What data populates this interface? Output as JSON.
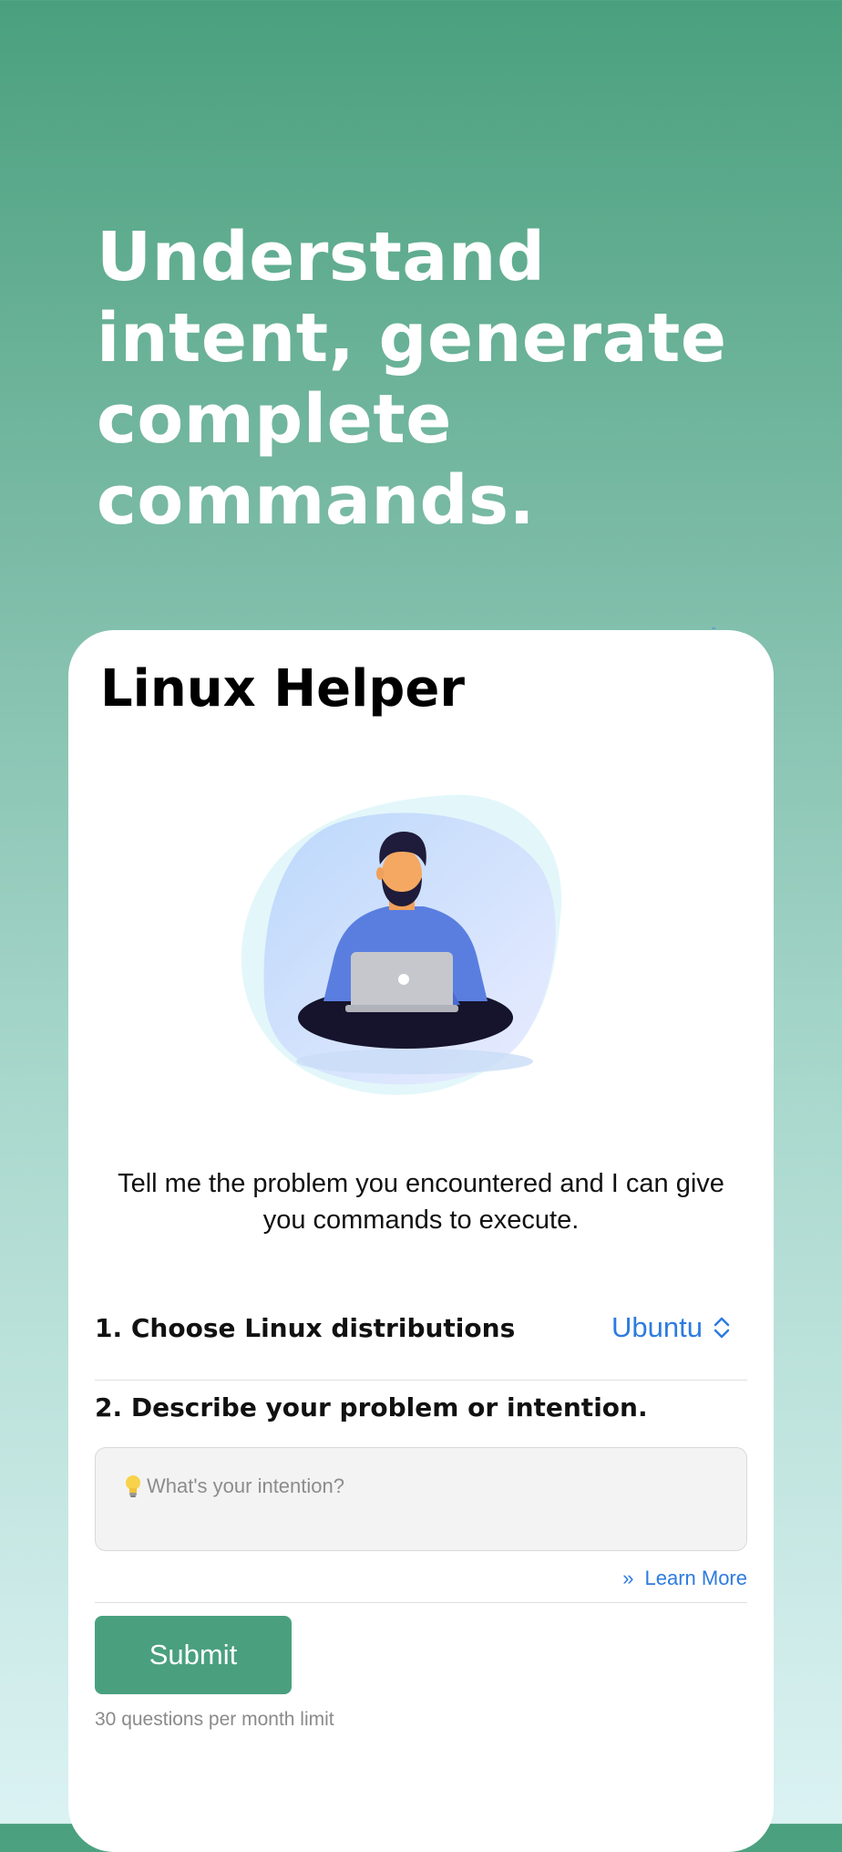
{
  "hero": {
    "headline": "Understand intent, generate complete commands."
  },
  "card": {
    "title": "Linux Helper",
    "description": "Tell me the problem you encountered and I can give you commands to execute.",
    "step1_label": "1. Choose Linux distributions",
    "distro_selected": "Ubuntu",
    "step2_label": "2. Describe your problem or intention.",
    "intent_placeholder": "What's your intention?",
    "intent_value": "",
    "learn_more_label": "Learn More",
    "submit_label": "Submit",
    "limit_note": "30 questions per month limit"
  },
  "icons": {
    "bulb": "lightbulb-icon",
    "distro_chevron": "chevron-up-down-icon",
    "learn_more": "double-chevron-right-icon"
  },
  "colors": {
    "accent_green": "#4aa07e",
    "link_blue": "#2d7be0"
  }
}
